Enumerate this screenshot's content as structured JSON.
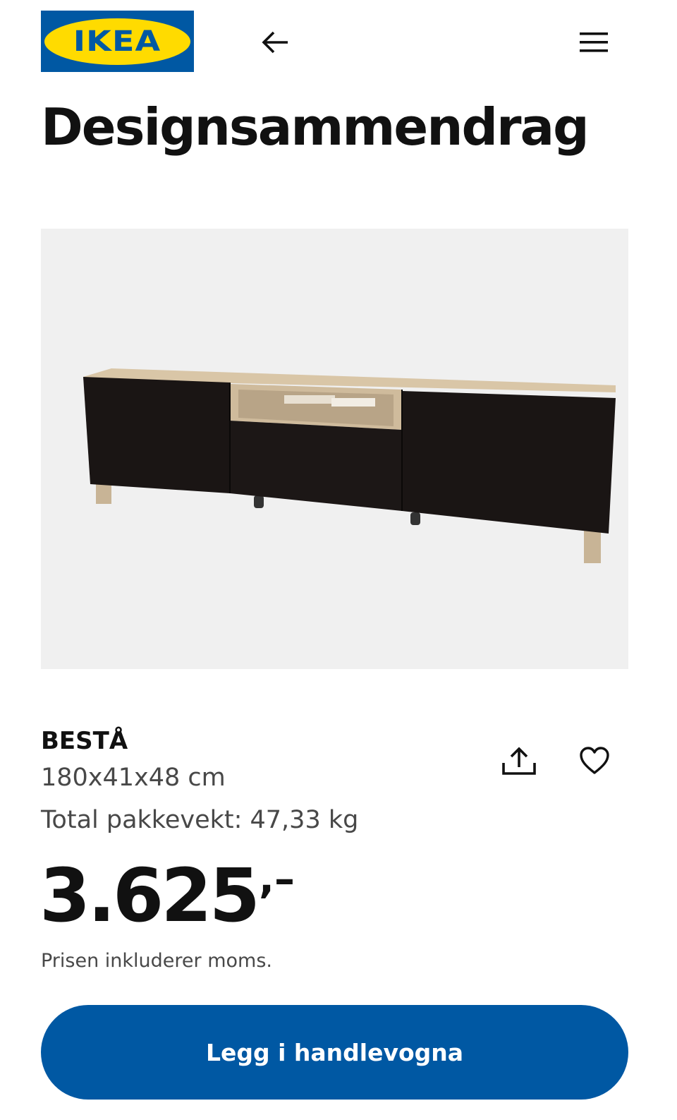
{
  "header": {
    "logo_text": "IKEA",
    "back_icon": "arrow-left-icon",
    "menu_icon": "hamburger-menu-icon"
  },
  "page_title": "Designsammendrag",
  "product": {
    "image_alt_icon": "tv-bench-image",
    "name": "BESTÅ",
    "dimensions": "180x41x48 cm",
    "weight": "Total pakkevekt: 47,33 kg",
    "share_icon": "share-icon",
    "favorite_icon": "heart-icon"
  },
  "price": {
    "integer": "3.625",
    "decimal": ",–",
    "note": "Prisen inkluderer moms."
  },
  "cart_button": {
    "label": "Legg i handlevogna"
  },
  "colors": {
    "brand_blue": "#0058a3",
    "brand_yellow": "#ffdb00",
    "text_primary": "#111111",
    "text_secondary": "#484848",
    "image_background": "#f0f0f0"
  }
}
